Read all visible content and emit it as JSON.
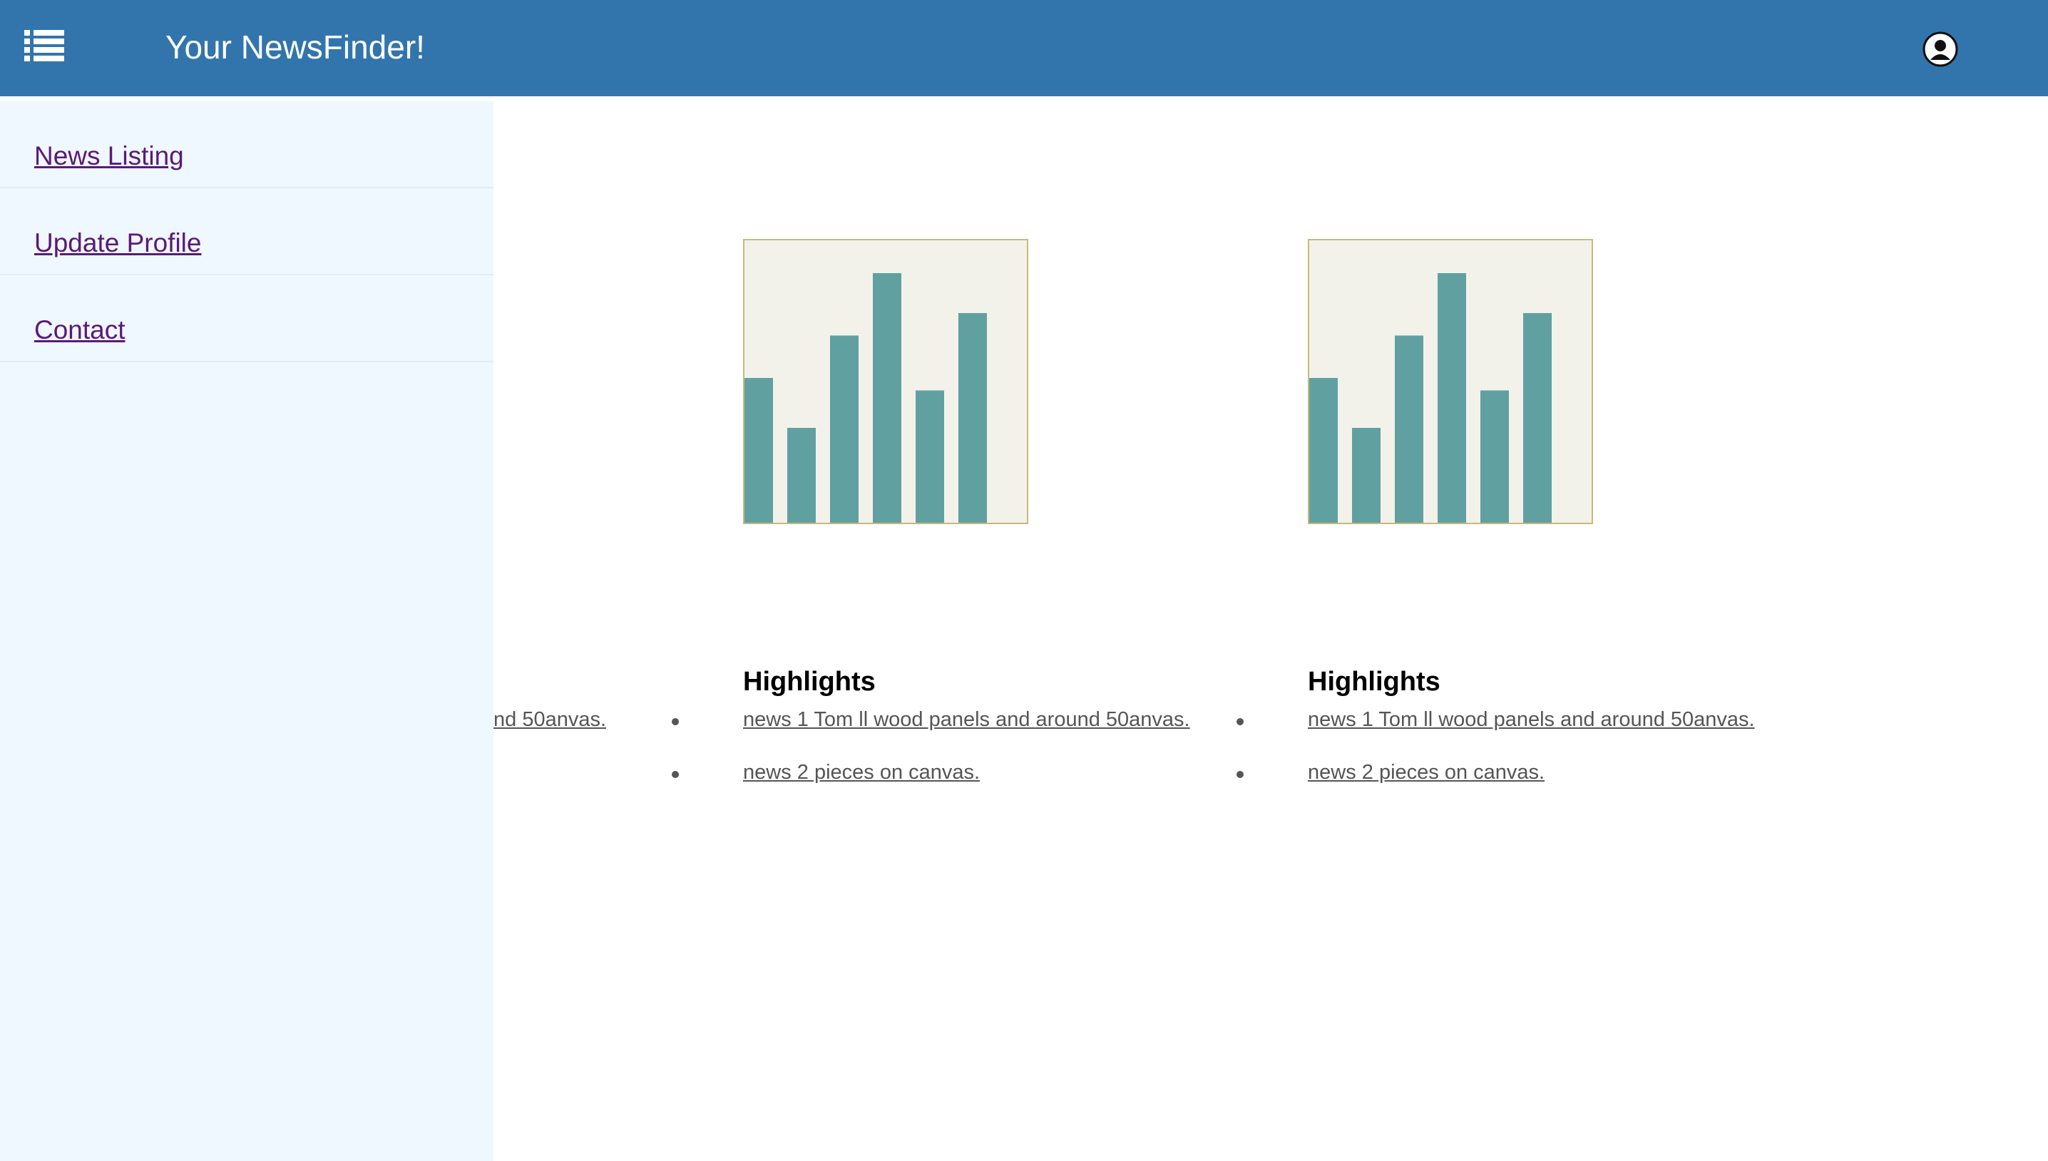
{
  "header": {
    "title": "Your NewsFinder!",
    "menu_icon": "list-icon",
    "profile_icon": "user-circle-icon",
    "background": "#3275ad"
  },
  "sidebar": {
    "background": "#eff7ff",
    "items": [
      {
        "label": "News Listing"
      },
      {
        "label": "Update Profile"
      },
      {
        "label": "Contact"
      }
    ]
  },
  "panels": [
    {
      "heading": "Highlights",
      "news": [
        {
          "text": "news 1 Tom ll wood panels and around 50anvas."
        },
        {
          "text": "news 2 pieces on canvas."
        }
      ]
    },
    {
      "heading": "Highlights",
      "news": [
        {
          "text": "news 1 Tom ll wood panels and around 50anvas."
        },
        {
          "text": "news 2 pieces on canvas."
        }
      ]
    }
  ],
  "partial_panel": {
    "news_fragment": "nd 50anvas."
  },
  "chart_data": [
    {
      "type": "bar",
      "values": [
        58,
        38,
        75,
        100,
        53,
        84
      ],
      "ylim": [
        0,
        100
      ],
      "bar_color": "#61a0a0",
      "background": "#f2f2ea",
      "border": "#c8b97a"
    },
    {
      "type": "bar",
      "values": [
        58,
        38,
        75,
        100,
        53,
        84
      ],
      "ylim": [
        0,
        100
      ],
      "bar_color": "#61a0a0",
      "background": "#f2f2ea",
      "border": "#c8b97a"
    }
  ]
}
